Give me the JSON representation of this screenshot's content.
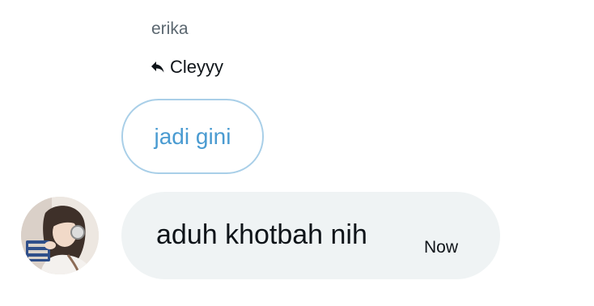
{
  "message": {
    "sender_name": "erika",
    "reply_to": {
      "icon": "reply-arrow-icon",
      "name": "Cleyyy"
    },
    "quoted_text": "jadi gini",
    "text": "aduh khotbah nih",
    "timestamp": "Now"
  },
  "colors": {
    "quoted_border": "#a9cfe8",
    "quoted_text": "#4a9bd1",
    "bubble_bg": "#eff3f4",
    "text": "#0f1419",
    "muted": "#5b6770"
  }
}
